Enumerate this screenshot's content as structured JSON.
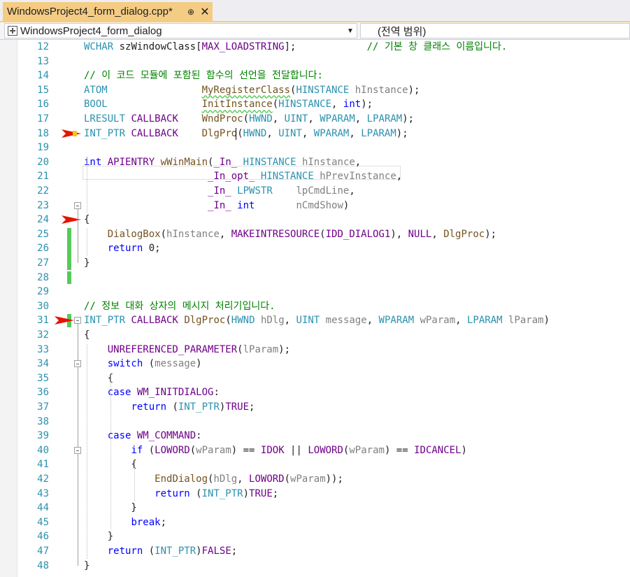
{
  "tab": {
    "title": "WindowsProject4_form_dialog.cpp*",
    "pin": "⊕",
    "close": "✕"
  },
  "navbar": {
    "left_label": "WindowsProject4_form_dialog",
    "right_label": "(전역 범위)"
  },
  "colors": {
    "keyword": "#0000ff",
    "type": "#2b91af",
    "comment": "#008000",
    "macro": "#6f008a",
    "function": "#74531f",
    "param": "#808080",
    "line_number": "#2b91af",
    "change_bar": "#57c958",
    "breakpoint_arrow": "#e51400"
  },
  "lines": [
    {
      "n": "12",
      "t": [
        [
          "type",
          "WCHAR"
        ],
        [
          "p",
          " szWindowClass["
        ],
        [
          "macro",
          "MAX_LOADSTRING"
        ],
        [
          "p",
          "];            "
        ],
        [
          "comment",
          "// 기본 창 클래스 이름입니다."
        ]
      ]
    },
    {
      "n": "13",
      "t": []
    },
    {
      "n": "14",
      "t": [
        [
          "comment",
          "// 이 코드 모듈에 포함된 함수의 선언을 전달합니다:"
        ]
      ]
    },
    {
      "n": "15",
      "t": [
        [
          "type",
          "ATOM"
        ],
        [
          "p",
          "                "
        ],
        [
          "func",
          "MyRegisterClass"
        ],
        [
          "p",
          "("
        ],
        [
          "type",
          "HINSTANCE"
        ],
        [
          "p",
          " "
        ],
        [
          "param",
          "hInstance"
        ],
        [
          "p",
          ");"
        ]
      ]
    },
    {
      "n": "16",
      "t": [
        [
          "type",
          "BOOL"
        ],
        [
          "p",
          "                "
        ],
        [
          "func",
          "InitInstance"
        ],
        [
          "p",
          "("
        ],
        [
          "type",
          "HINSTANCE"
        ],
        [
          "p",
          ", "
        ],
        [
          "kw",
          "int"
        ],
        [
          "p",
          ");"
        ]
      ]
    },
    {
      "n": "17",
      "t": [
        [
          "type",
          "LRESULT"
        ],
        [
          "p",
          " "
        ],
        [
          "macro",
          "CALLBACK"
        ],
        [
          "p",
          "    "
        ],
        [
          "func",
          "WndProc"
        ],
        [
          "p",
          "("
        ],
        [
          "type",
          "HWND"
        ],
        [
          "p",
          ", "
        ],
        [
          "type",
          "UINT"
        ],
        [
          "p",
          ", "
        ],
        [
          "type",
          "WPARAM"
        ],
        [
          "p",
          ", "
        ],
        [
          "type",
          "LPARAM"
        ],
        [
          "p",
          ");"
        ]
      ]
    },
    {
      "n": "18",
      "t": [
        [
          "type",
          "INT_PTR"
        ],
        [
          "p",
          " "
        ],
        [
          "macro",
          "CALLBACK"
        ],
        [
          "p",
          "    "
        ],
        [
          "func",
          "DlgPro"
        ],
        [
          "p",
          "("
        ],
        [
          "type",
          "HWND"
        ],
        [
          "p",
          ", "
        ],
        [
          "type",
          "UINT"
        ],
        [
          "p",
          ", "
        ],
        [
          "type",
          "WPARAM"
        ],
        [
          "p",
          ", "
        ],
        [
          "type",
          "LPARAM"
        ],
        [
          "p",
          ");"
        ]
      ]
    },
    {
      "n": "19",
      "t": []
    },
    {
      "n": "20",
      "t": [
        [
          "kw",
          "int"
        ],
        [
          "p",
          " "
        ],
        [
          "macro",
          "APIENTRY"
        ],
        [
          "p",
          " "
        ],
        [
          "func",
          "wWinMain"
        ],
        [
          "p",
          "("
        ],
        [
          "macro",
          "_In_"
        ],
        [
          "p",
          " "
        ],
        [
          "type",
          "HINSTANCE"
        ],
        [
          "p",
          " "
        ],
        [
          "param",
          "hInstance"
        ],
        [
          "p",
          ","
        ]
      ]
    },
    {
      "n": "21",
      "t": [
        [
          "p",
          "                     "
        ],
        [
          "macro",
          "_In_opt_"
        ],
        [
          "p",
          " "
        ],
        [
          "type",
          "HINSTANCE"
        ],
        [
          "p",
          " "
        ],
        [
          "param",
          "hPrevInstance"
        ],
        [
          "p",
          ","
        ]
      ]
    },
    {
      "n": "22",
      "t": [
        [
          "p",
          "                     "
        ],
        [
          "macro",
          "_In_"
        ],
        [
          "p",
          " "
        ],
        [
          "type",
          "LPWSTR"
        ],
        [
          "p",
          "    "
        ],
        [
          "param",
          "lpCmdLine"
        ],
        [
          "p",
          ","
        ]
      ]
    },
    {
      "n": "23",
      "t": [
        [
          "p",
          "                     "
        ],
        [
          "macro",
          "_In_"
        ],
        [
          "p",
          " "
        ],
        [
          "kw",
          "int"
        ],
        [
          "p",
          "       "
        ],
        [
          "param",
          "nCmdShow"
        ],
        [
          "p",
          ")"
        ]
      ]
    },
    {
      "n": "24",
      "t": [
        [
          "p",
          "{"
        ]
      ]
    },
    {
      "n": "25",
      "t": [
        [
          "p",
          "    "
        ],
        [
          "func",
          "DialogBox"
        ],
        [
          "p",
          "("
        ],
        [
          "param",
          "hInstance"
        ],
        [
          "p",
          ", "
        ],
        [
          "macro",
          "MAKEINTRESOURCE"
        ],
        [
          "p",
          "("
        ],
        [
          "macro",
          "IDD_DIALOG1"
        ],
        [
          "p",
          "), "
        ],
        [
          "macro",
          "NULL"
        ],
        [
          "p",
          ", "
        ],
        [
          "func",
          "DlgProc"
        ],
        [
          "p",
          ");"
        ]
      ]
    },
    {
      "n": "26",
      "t": [
        [
          "p",
          "    "
        ],
        [
          "kw",
          "return"
        ],
        [
          "p",
          " 0;"
        ]
      ]
    },
    {
      "n": "27",
      "t": [
        [
          "p",
          "}"
        ]
      ]
    },
    {
      "n": "28",
      "t": []
    },
    {
      "n": "29",
      "t": []
    },
    {
      "n": "30",
      "t": [
        [
          "comment",
          "// 정보 대화 상자의 메시지 처리기입니다."
        ]
      ]
    },
    {
      "n": "31",
      "t": [
        [
          "type",
          "INT_PTR"
        ],
        [
          "p",
          " "
        ],
        [
          "macro",
          "CALLBACK"
        ],
        [
          "p",
          " "
        ],
        [
          "func",
          "DlgProc"
        ],
        [
          "p",
          "("
        ],
        [
          "type",
          "HWND"
        ],
        [
          "p",
          " "
        ],
        [
          "param",
          "hDlg"
        ],
        [
          "p",
          ", "
        ],
        [
          "type",
          "UINT"
        ],
        [
          "p",
          " "
        ],
        [
          "param",
          "message"
        ],
        [
          "p",
          ", "
        ],
        [
          "type",
          "WPARAM"
        ],
        [
          "p",
          " "
        ],
        [
          "param",
          "wParam"
        ],
        [
          "p",
          ", "
        ],
        [
          "type",
          "LPARAM"
        ],
        [
          "p",
          " "
        ],
        [
          "param",
          "lParam"
        ],
        [
          "p",
          ")"
        ]
      ]
    },
    {
      "n": "32",
      "t": [
        [
          "p",
          "{"
        ]
      ]
    },
    {
      "n": "33",
      "t": [
        [
          "p",
          "    "
        ],
        [
          "macro",
          "UNREFERENCED_PARAMETER"
        ],
        [
          "p",
          "("
        ],
        [
          "param",
          "lParam"
        ],
        [
          "p",
          ");"
        ]
      ]
    },
    {
      "n": "34",
      "t": [
        [
          "p",
          "    "
        ],
        [
          "kw",
          "switch"
        ],
        [
          "p",
          " ("
        ],
        [
          "param",
          "message"
        ],
        [
          "p",
          ")"
        ]
      ]
    },
    {
      "n": "35",
      "t": [
        [
          "p",
          "    {"
        ]
      ]
    },
    {
      "n": "36",
      "t": [
        [
          "p",
          "    "
        ],
        [
          "kw",
          "case"
        ],
        [
          "p",
          " "
        ],
        [
          "macro",
          "WM_INITDIALOG"
        ],
        [
          "p",
          ":"
        ]
      ]
    },
    {
      "n": "37",
      "t": [
        [
          "p",
          "        "
        ],
        [
          "kw",
          "return"
        ],
        [
          "p",
          " ("
        ],
        [
          "type",
          "INT_PTR"
        ],
        [
          "p",
          ")"
        ],
        [
          "macro",
          "TRUE"
        ],
        [
          "p",
          ";"
        ]
      ]
    },
    {
      "n": "38",
      "t": []
    },
    {
      "n": "39",
      "t": [
        [
          "p",
          "    "
        ],
        [
          "kw",
          "case"
        ],
        [
          "p",
          " "
        ],
        [
          "macro",
          "WM_COMMAND"
        ],
        [
          "p",
          ":"
        ]
      ]
    },
    {
      "n": "40",
      "t": [
        [
          "p",
          "        "
        ],
        [
          "kw",
          "if"
        ],
        [
          "p",
          " ("
        ],
        [
          "macro",
          "LOWORD"
        ],
        [
          "p",
          "("
        ],
        [
          "param",
          "wParam"
        ],
        [
          "p",
          ") == "
        ],
        [
          "macro",
          "IDOK"
        ],
        [
          "p",
          " || "
        ],
        [
          "macro",
          "LOWORD"
        ],
        [
          "p",
          "("
        ],
        [
          "param",
          "wParam"
        ],
        [
          "p",
          ") == "
        ],
        [
          "macro",
          "IDCANCEL"
        ],
        [
          "p",
          ")"
        ]
      ]
    },
    {
      "n": "41",
      "t": [
        [
          "p",
          "        {"
        ]
      ]
    },
    {
      "n": "42",
      "t": [
        [
          "p",
          "            "
        ],
        [
          "func",
          "EndDialog"
        ],
        [
          "p",
          "("
        ],
        [
          "param",
          "hDlg"
        ],
        [
          "p",
          ", "
        ],
        [
          "macro",
          "LOWORD"
        ],
        [
          "p",
          "("
        ],
        [
          "param",
          "wParam"
        ],
        [
          "p",
          "));"
        ]
      ]
    },
    {
      "n": "43",
      "t": [
        [
          "p",
          "            "
        ],
        [
          "kw",
          "return"
        ],
        [
          "p",
          " ("
        ],
        [
          "type",
          "INT_PTR"
        ],
        [
          "p",
          ")"
        ],
        [
          "macro",
          "TRUE"
        ],
        [
          "p",
          ";"
        ]
      ]
    },
    {
      "n": "44",
      "t": [
        [
          "p",
          "        }"
        ]
      ]
    },
    {
      "n": "45",
      "t": [
        [
          "p",
          "        "
        ],
        [
          "kw",
          "break"
        ],
        [
          "p",
          ";"
        ]
      ]
    },
    {
      "n": "46",
      "t": [
        [
          "p",
          "    }"
        ]
      ]
    },
    {
      "n": "47",
      "t": [
        [
          "p",
          "    "
        ],
        [
          "kw",
          "return"
        ],
        [
          "p",
          " ("
        ],
        [
          "type",
          "INT_PTR"
        ],
        [
          "p",
          ")"
        ],
        [
          "macro",
          "FALSE"
        ],
        [
          "p",
          ";"
        ]
      ]
    },
    {
      "n": "48",
      "t": [
        [
          "p",
          "}"
        ]
      ]
    }
  ]
}
